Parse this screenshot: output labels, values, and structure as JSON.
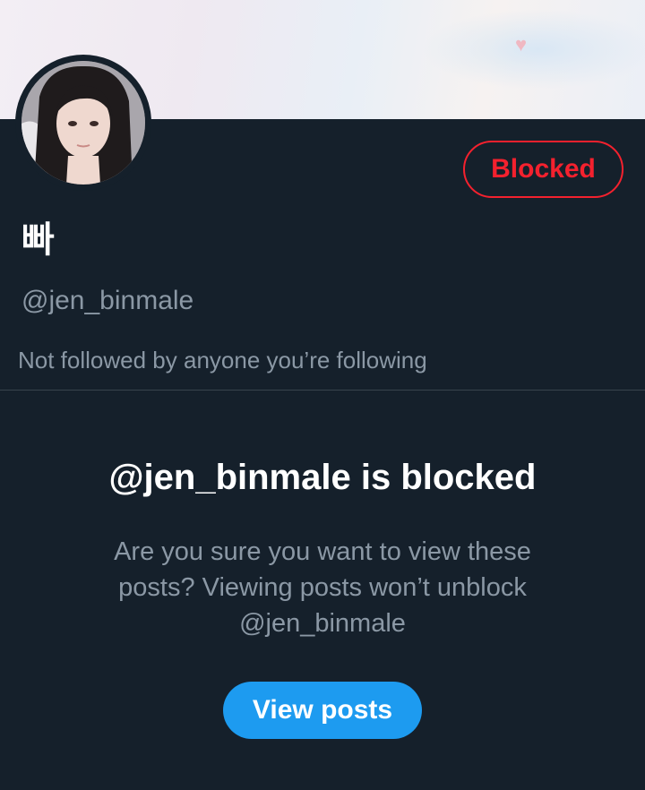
{
  "profile": {
    "display_name": "빠",
    "handle": "@jen_binmale",
    "follow_context": "Not followed by anyone you’re following",
    "blocked_label": "Blocked"
  },
  "blocked_notice": {
    "title": "@jen_binmale is blocked",
    "description_line1": "Are you sure you want to view these",
    "description_line2": "posts? Viewing posts won’t unblock",
    "description_handle": "@jen_binmale",
    "view_posts_label": "View posts"
  },
  "colors": {
    "background": "#15202b",
    "blocked_red": "#f4212e",
    "accent_blue": "#1d9bf0",
    "muted_text": "#8b98a5"
  },
  "icons": {
    "banner_decoration": "heart-icon"
  }
}
